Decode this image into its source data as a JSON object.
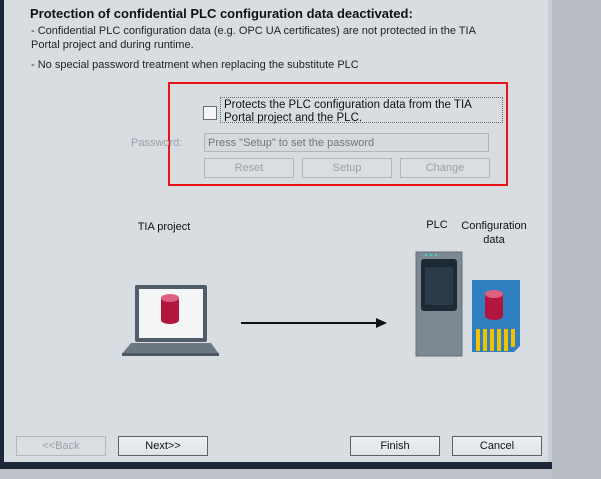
{
  "heading": "Protection of confidential PLC configuration data deactivated:",
  "description": {
    "line1": "- Confidential PLC configuration data (e.g. OPC UA certificates) are not protected in the TIA",
    "line2": "Portal project and during runtime.",
    "line3": "- No special password treatment when replacing the substitute PLC"
  },
  "protection": {
    "checkbox_label": "Protects the PLC configuration data from the TIA Portal project and the PLC.",
    "checked": false,
    "password_label": "Password:",
    "password_placeholder": "Press \"Setup\" to set the password",
    "reset_label": "Reset",
    "setup_label": "Setup",
    "change_label": "Change"
  },
  "diagram": {
    "tia_project_label": "TIA project",
    "plc_label": "PLC",
    "config_label_line1": "Configuration",
    "config_label_line2": "data"
  },
  "footer": {
    "back_label": "<<Back",
    "next_label": "Next>>",
    "finish_label": "Finish",
    "cancel_label": "Cancel"
  },
  "colors": {
    "highlight": "#e8141b",
    "database": "#b2163f",
    "sd_pins": "#f2c200"
  }
}
